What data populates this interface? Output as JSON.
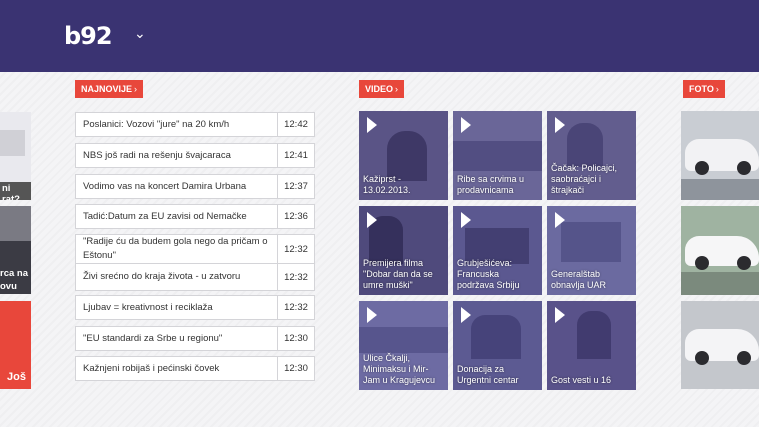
{
  "header": {
    "logo": "b92",
    "logo_chevron": "⌄"
  },
  "sections": {
    "najnovije": "NAJNOVIJE",
    "video": "VIDEO",
    "foto": "FOTO",
    "arrow": "›"
  },
  "left_strip": {
    "text1": "ni rat?",
    "text2": "rca na",
    "text3": "ovu",
    "more": "Još"
  },
  "news": [
    {
      "title": "Poslanici: Vozovi \"jure\" na 20 km/h",
      "time": "12:42"
    },
    {
      "title": "NBS još radi na rešenju švajcaraca",
      "time": "12:41"
    },
    {
      "title": "Vodimo vas na koncert Damira Urbana",
      "time": "12:37"
    },
    {
      "title": "Tadić:Datum za EU zavisi od Nemačke",
      "time": "12:36"
    },
    {
      "title": "\"Radije ću da budem gola nego da pričam o Eštonu\"",
      "time": "12:32"
    },
    {
      "title": "Živi srećno do kraja života - u zatvoru",
      "time": "12:32"
    },
    {
      "title": "Ljubav = kreativnost i reciklaža",
      "time": "12:32"
    },
    {
      "title": "\"EU standardi za Srbe u regionu\"",
      "time": "12:30"
    },
    {
      "title": "Kažnjeni robijaš i pećinski čovek",
      "time": "12:30"
    }
  ],
  "videos": [
    {
      "caption": "Kažiprst - 13.02.2013.",
      "color": "#5a5486"
    },
    {
      "caption": "Ribe sa crvima u prodavnicama",
      "color": "#6a6698"
    },
    {
      "caption": "Čačak: Policajci, saobraćajci i štrajkači",
      "color": "#625d8e"
    },
    {
      "caption": "Premijera filma \"Dobar dan da se umre muški\"",
      "color": "#4f4a7c"
    },
    {
      "caption": "Grubješićeva: Francuska podržava Srbiju",
      "color": "#5b5890"
    },
    {
      "caption": "Generalštab obnavlja UAR",
      "color": "#6b6aa0"
    },
    {
      "caption": "Ulice Čkalji, Minimaksu i Mir-Jam u Kragujevcu",
      "color": "#6d6ba3"
    },
    {
      "caption": "Donacija za Urgentni centar",
      "color": "#5c5a92"
    },
    {
      "caption": "Gost vesti u 16",
      "color": "#59528a"
    }
  ]
}
